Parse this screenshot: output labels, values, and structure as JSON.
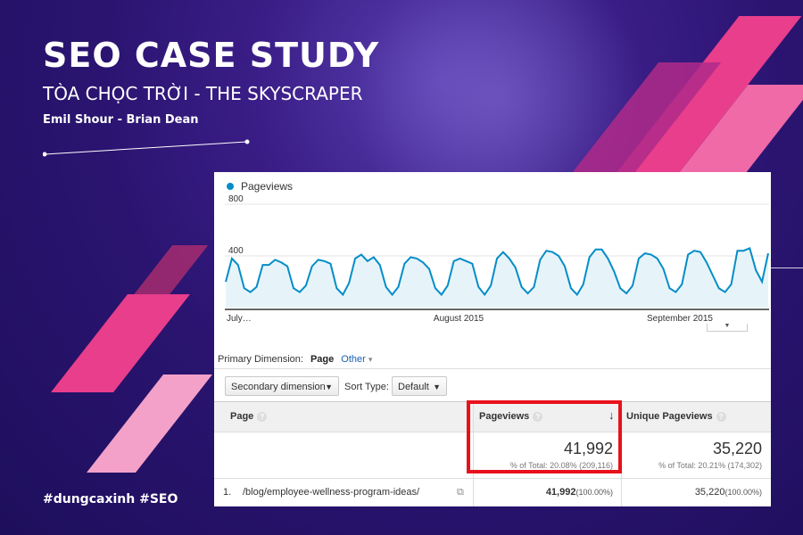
{
  "banner": {
    "title": "SEO CASE STUDY",
    "subtitle": "TÒA CHỌC TRỜI - THE SKYSCRAPER",
    "authors": "Emil Shour - Brian Dean",
    "hashtags": "#dungcaxinh #SEO"
  },
  "colors": {
    "accent_pink": "#e83e8c",
    "line": "#058dc7",
    "highlight": "#e8111b"
  },
  "analytics": {
    "legend": "Pageviews",
    "primary_dimension_label": "Primary Dimension:",
    "primary_dimension_value": "Page",
    "other_label": "Other",
    "secondary_dimension_button": "Secondary dimension",
    "sort_type_label": "Sort Type:",
    "sort_type_value": "Default",
    "columns": [
      "Page",
      "Pageviews",
      "Unique Pageviews"
    ],
    "totals": {
      "pageviews": "41,992",
      "pageviews_pct": "% of Total: 20.08% (209,116)",
      "unique": "35,220",
      "unique_pct": "% of Total: 20.21% (174,302)"
    },
    "rows": [
      {
        "index": "1.",
        "page": "/blog/employee-wellness-program-ideas/",
        "pageviews": "41,992",
        "pageviews_pct": "(100.00%)",
        "unique": "35,220",
        "unique_pct": "(100.00%)"
      }
    ]
  },
  "chart_data": {
    "type": "area",
    "series": [
      {
        "name": "Pageviews",
        "values": [
          200,
          380,
          330,
          150,
          120,
          160,
          330,
          330,
          370,
          350,
          320,
          150,
          120,
          170,
          320,
          370,
          360,
          340,
          150,
          100,
          190,
          380,
          410,
          360,
          390,
          330,
          160,
          100,
          160,
          340,
          390,
          380,
          350,
          300,
          150,
          100,
          170,
          360,
          380,
          360,
          340,
          160,
          100,
          170,
          380,
          430,
          380,
          310,
          160,
          110,
          160,
          370,
          440,
          430,
          400,
          320,
          150,
          100,
          180,
          390,
          450,
          450,
          380,
          280,
          150,
          110,
          170,
          380,
          420,
          410,
          380,
          300,
          150,
          120,
          180,
          410,
          440,
          430,
          350,
          250,
          150,
          120,
          180,
          440,
          440,
          460,
          290,
          200,
          420
        ]
      }
    ],
    "x_tick_labels": [
      "July…",
      "August 2015",
      "September 2015"
    ],
    "y_tick_labels": [
      "800",
      "400"
    ],
    "ylim": [
      0,
      800
    ],
    "grid": true
  }
}
